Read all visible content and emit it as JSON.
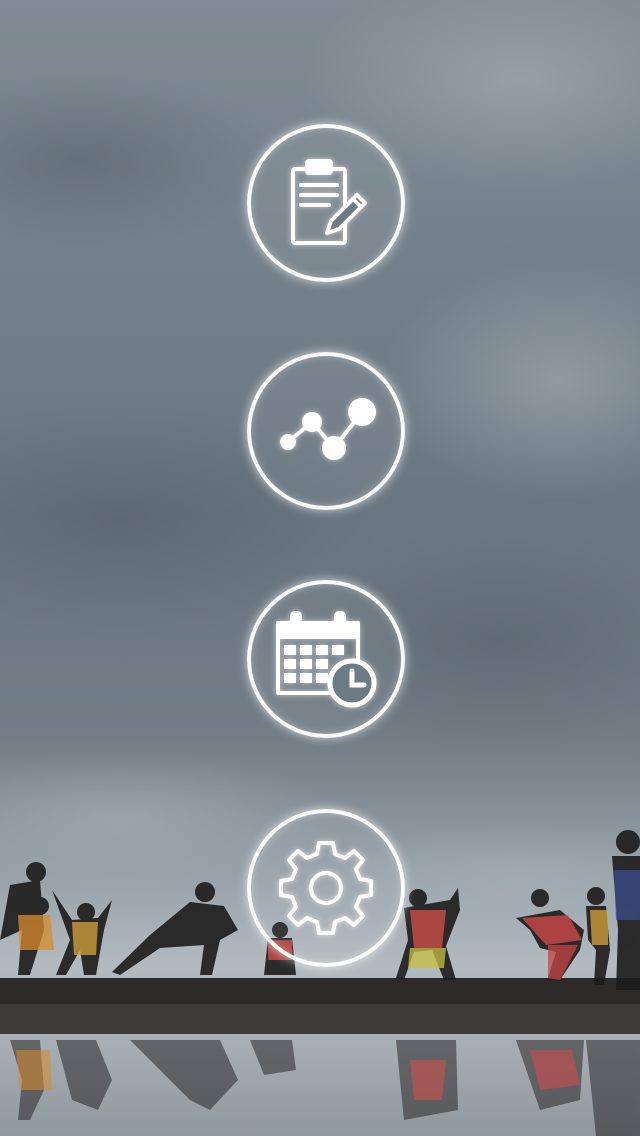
{
  "menu": {
    "items": [
      {
        "id": "notes",
        "icon": "clipboard-pencil-icon",
        "label": ""
      },
      {
        "id": "stats",
        "icon": "line-graph-icon",
        "label": ""
      },
      {
        "id": "schedule",
        "icon": "calendar-clock-icon",
        "label": ""
      },
      {
        "id": "settings",
        "icon": "gear-icon",
        "label": ""
      }
    ]
  },
  "colors": {
    "icon_stroke": "#ffffff",
    "sky": "#76828b",
    "ground": "#2b2a28"
  }
}
